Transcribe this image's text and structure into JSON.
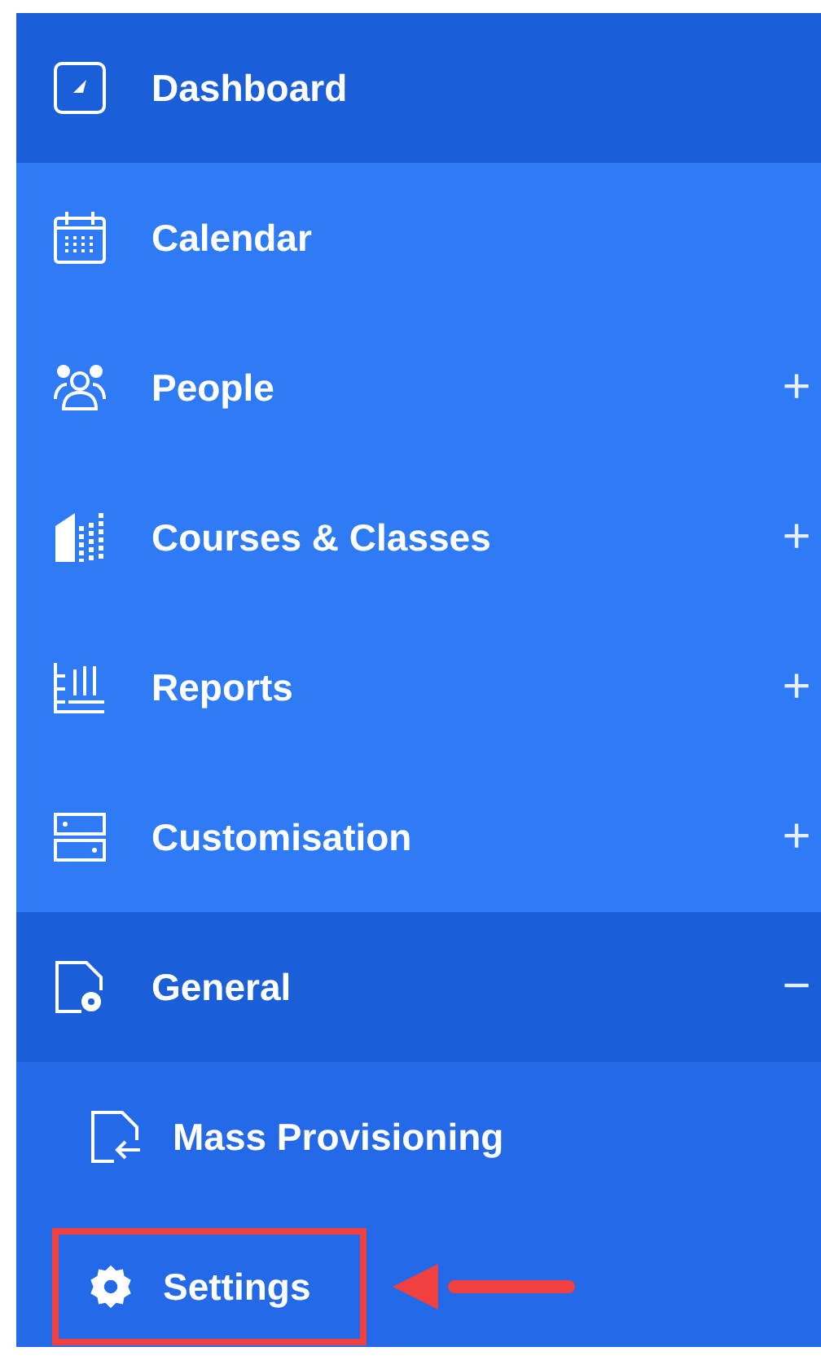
{
  "sidebar": {
    "items": [
      {
        "label": "Dashboard",
        "selected": true
      },
      {
        "label": "Calendar",
        "selected": false
      },
      {
        "label": "People",
        "selected": false,
        "toggle": "+",
        "expanded": false
      },
      {
        "label": "Courses & Classes",
        "selected": false,
        "toggle": "+",
        "expanded": false
      },
      {
        "label": "Reports",
        "selected": false,
        "toggle": "+",
        "expanded": false
      },
      {
        "label": "Customisation",
        "selected": false,
        "toggle": "+",
        "expanded": false
      },
      {
        "label": "General",
        "toggle": "−",
        "expanded": true,
        "children": [
          {
            "label": "Mass Provisioning",
            "highlighted": false
          },
          {
            "label": "Settings",
            "highlighted": true
          }
        ]
      }
    ]
  }
}
